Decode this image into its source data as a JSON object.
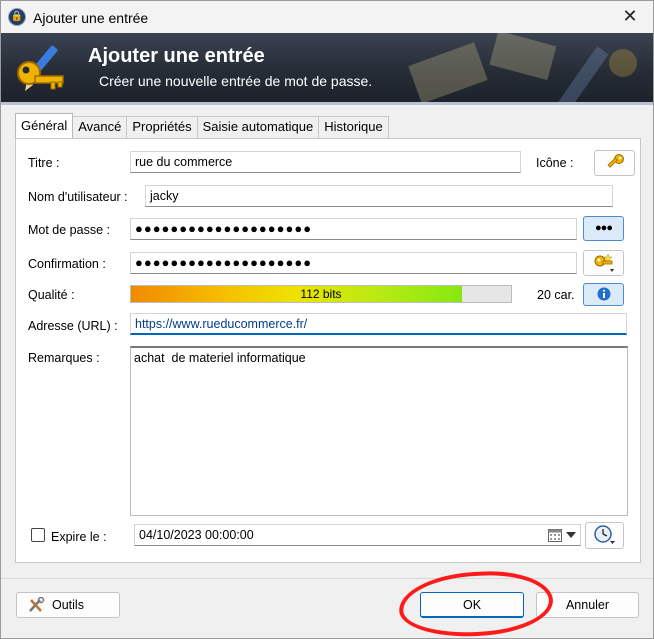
{
  "window": {
    "title": "Ajouter une entrée",
    "close_glyph": "✕"
  },
  "banner": {
    "title": "Ajouter une entrée",
    "subtitle": "Créer une nouvelle entrée de mot de passe."
  },
  "tabs": [
    {
      "label": "Général",
      "active": true
    },
    {
      "label": "Avancé"
    },
    {
      "label": "Propriétés"
    },
    {
      "label": "Saisie automatique"
    },
    {
      "label": "Historique"
    }
  ],
  "form": {
    "title_label": "Titre :",
    "title_value": "rue du commerce",
    "icon_label": "Icône :",
    "username_label": "Nom d'utilisateur :",
    "username_value": "jacky",
    "password_label": "Mot de passe :",
    "password_value": "●●●●●●●●●●●●●●●●●●●●",
    "show_password_glyph": "●●●",
    "confirm_label": "Confirmation :",
    "confirm_value": "●●●●●●●●●●●●●●●●●●●●",
    "quality_label": "Qualité :",
    "quality_text": "112 bits",
    "quality_fraction": 0.87,
    "char_count": "20 car.",
    "url_label": "Adresse (URL) :",
    "url_value": "https://www.rueducommerce.fr/",
    "notes_label": "Remarques :",
    "notes_value": "achat  de materiel informatique",
    "expires_label": "Expire le :",
    "expires_checked": false,
    "expires_value": "04/10/2023 00:00:00"
  },
  "footer": {
    "tools_label": "Outils",
    "ok_label": "OK",
    "cancel_label": "Annuler"
  },
  "colors": {
    "banner_bg": "#262c36",
    "accent_blue": "#0067c0",
    "annotation_red": "#ff1a1a"
  },
  "icons": {
    "app": "lock-icon",
    "banner": "key-pencil-icon",
    "entry_icon": "key-icon",
    "generate": "password-generator-icon",
    "info": "info-icon",
    "calendar": "calendar-icon",
    "clock": "clock-icon",
    "tools": "tools-icon"
  }
}
